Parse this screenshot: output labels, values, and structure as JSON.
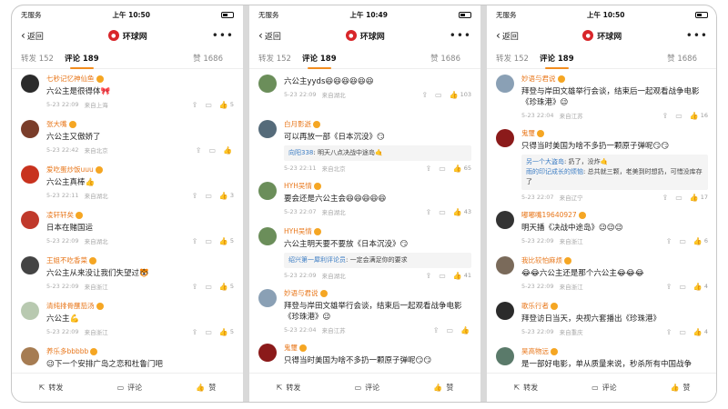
{
  "screens": [
    {
      "status": {
        "carrier": "无服务",
        "time": "上午 10:50"
      },
      "nav": {
        "back": "返回",
        "title": "环球网",
        "more": "•••"
      },
      "tabs": {
        "repost": "转发 152",
        "comments": "评论 189",
        "likes": "赞 1686"
      },
      "comments": [
        {
          "user": "七秒记忆神仙鱼",
          "text": "六公主是很得体🎀",
          "time": "5-23 22:09",
          "loc": "来自上海",
          "likes": "5",
          "color": "#2b2b2b"
        },
        {
          "user": "张大嘴",
          "text": "六公主又傲娇了",
          "time": "5-23 22:42",
          "loc": "来自北京",
          "likes": "",
          "color": "#7a3d2a"
        },
        {
          "user": "爱吃蛋炒饭uuu",
          "text": "六公主真棒👍",
          "time": "5-23 22:11",
          "loc": "来自湖北",
          "likes": "3",
          "color": "#c8321e"
        },
        {
          "user": "凌轩轩矣",
          "text": "日本在赌国运",
          "time": "5-23 22:09",
          "loc": "来自湖北",
          "likes": "5",
          "color": "#c0392b"
        },
        {
          "user": "王姐不吃香菜",
          "text": "六公主从来没让我们失望过🐯",
          "time": "5-23 22:09",
          "loc": "来自浙江",
          "likes": "5",
          "color": "#444444"
        },
        {
          "user": "清纯排骨蘸茄汤",
          "text": "六公主💪",
          "time": "5-23 22:09",
          "loc": "来自浙江",
          "likes": "5",
          "color": "#b8c9b0"
        },
        {
          "user": "养乐多bbbbb",
          "text": "😉下一个安排广岛之恋和杜鲁门吧",
          "time": "",
          "loc": "",
          "likes": "",
          "color": "#a67c52"
        }
      ],
      "bottom": {
        "repost": "转发",
        "comment": "评论",
        "like": "赞"
      }
    },
    {
      "status": {
        "carrier": "无服务",
        "time": "上午 10:49"
      },
      "nav": {
        "back": "返回",
        "title": "环球网",
        "more": "•••"
      },
      "tabs": {
        "repost": "转发 152",
        "comments": "评论 189",
        "likes": "赞 1686"
      },
      "comments": [
        {
          "user": "",
          "text": "六公主yyds😆😆😆😆😆😆",
          "time": "5-23 22:09",
          "loc": "来自湖北",
          "likes": "103",
          "color": "#6b8e5a"
        },
        {
          "user": "白月影逝",
          "text": "可以再放一部《日本沉没》😏",
          "time": "5-23 22:11",
          "loc": "来自北京",
          "likes": "65",
          "color": "#556b7a",
          "reply": {
            "name": "向阳338",
            "text": "明天八点决战中途岛🤙"
          }
        },
        {
          "user": "HYH吴情",
          "text": "要会还是六公主会😆😆😆😆😆",
          "time": "5-23 22:07",
          "loc": "来自湖北",
          "likes": "43",
          "color": "#6b8e5a"
        },
        {
          "user": "HYH吴情",
          "text": "六公主明天要不要放《日本沉没》😏",
          "time": "5-23 22:09",
          "loc": "来自湖北",
          "likes": "41",
          "color": "#6b8e5a",
          "reply": {
            "name": "绍兴第一犀利评论员",
            "text": "一定会满足你的要求"
          }
        },
        {
          "user": "妙语与君说",
          "text": "拜登与岸田文雄举行会谈，结束后一起观看战争电影《珍珠港》😉",
          "time": "5-23 22:04",
          "loc": "来自江苏",
          "likes": "",
          "color": "#8aa0b5"
        },
        {
          "user": "鬼璽",
          "text": "只得当时美国为啥不多扔一颗原子弹呢😏😏",
          "time": "",
          "loc": "",
          "likes": "",
          "color": "#8b1a1a"
        }
      ],
      "bottom": {
        "repost": "转发",
        "comment": "评论",
        "like": "赞"
      }
    },
    {
      "status": {
        "carrier": "无服务",
        "time": "上午 10:50"
      },
      "nav": {
        "back": "返回",
        "title": "环球网",
        "more": "•••"
      },
      "tabs": {
        "repost": "转发 152",
        "comments": "评论 189",
        "likes": "赞 1686"
      },
      "comments": [
        {
          "user": "妙语与君说",
          "text": "拜登与岸田文雄举行会谈，结束后一起观看战争电影《珍珠港》😉",
          "time": "5-23 22:04",
          "loc": "来自江苏",
          "likes": "16",
          "color": "#8aa0b5"
        },
        {
          "user": "鬼璽",
          "text": "只得当时美国为啥不多扔一颗原子弹呢😏😏",
          "time": "5-23 22:07",
          "loc": "来自辽宁",
          "likes": "17",
          "color": "#8b1a1a",
          "reply": {
            "name": "另一个大盗岛",
            "text": "扔了，没炸🤙",
            "name2": "雨的印记成长的烦恼",
            "text2": "总共就三颗，老美到时想扔，可惜没库存了"
          }
        },
        {
          "user": "嘟嘟嘴19640927",
          "text": "明天播《决战中途岛》😉😉😉",
          "time": "5-23 22:09",
          "loc": "来自浙江",
          "likes": "6",
          "color": "#333333"
        },
        {
          "user": "我比较怕麻烦",
          "text": "😂😂六公主还是那个六公主😂😂😂",
          "time": "5-23 22:09",
          "loc": "来自浙江",
          "likes": "4",
          "color": "#7a6a5a"
        },
        {
          "user": "歌乐行者",
          "text": "拜登访日当天，央视六套播出《珍珠港》",
          "time": "5-23 22:09",
          "loc": "来自重庆",
          "likes": "4",
          "color": "#2b2b2b"
        },
        {
          "user": "昊高物远",
          "text": "是一部好电影，单从质量来说，秒杀所有中国战争",
          "time": "",
          "loc": "",
          "likes": "",
          "color": "#5a7a6a"
        }
      ],
      "bottom": {
        "repost": "转发",
        "comment": "评论",
        "like": "赞"
      }
    }
  ]
}
